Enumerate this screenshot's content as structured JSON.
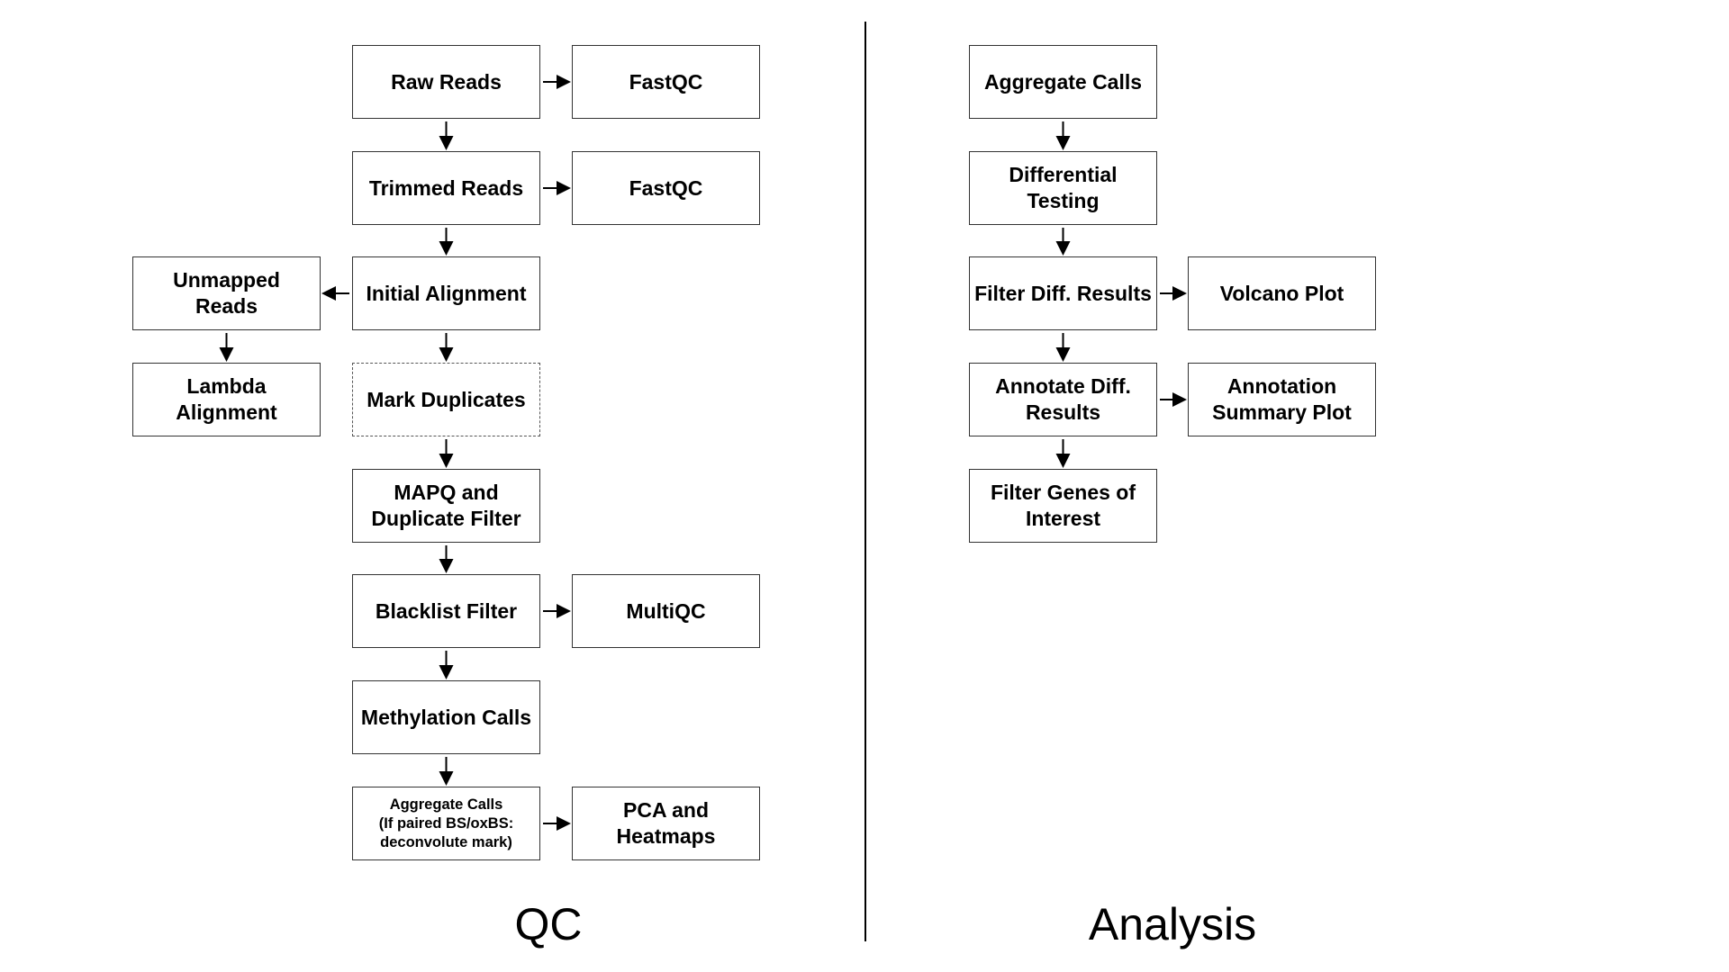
{
  "sections": {
    "qc": "QC",
    "analysis": "Analysis"
  },
  "boxes": [
    {
      "id": "raw_reads",
      "text": "Raw Reads"
    },
    {
      "id": "fastqc_1",
      "text": "FastQC"
    },
    {
      "id": "trimmed_reads",
      "text": "Trimmed Reads"
    },
    {
      "id": "fastqc_2",
      "text": "FastQC"
    },
    {
      "id": "unmapped_reads",
      "text": "Unmapped\nReads"
    },
    {
      "id": "initial_alignment",
      "text": "Initial Alignment"
    },
    {
      "id": "lambda_alignment",
      "text": "Lambda\nAlignment"
    },
    {
      "id": "mark_duplicates",
      "text": "Mark Duplicates",
      "style": "dashed"
    },
    {
      "id": "mapq_filter",
      "text": "MAPQ and\nDuplicate Filter"
    },
    {
      "id": "blacklist_filter",
      "text": "Blacklist Filter"
    },
    {
      "id": "multiqc",
      "text": "MultiQC"
    },
    {
      "id": "methylation_calls",
      "text": "Methylation Calls"
    },
    {
      "id": "aggregate_calls_qc",
      "text": "Aggregate Calls\n(If paired BS/oxBS:\ndeconvolute mark)",
      "style": "small"
    },
    {
      "id": "pca_heatmaps",
      "text": "PCA and\nHeatmaps"
    },
    {
      "id": "aggregate_calls",
      "text": "Aggregate Calls"
    },
    {
      "id": "differential_testing",
      "text": "Differential\nTesting"
    },
    {
      "id": "filter_diff_results",
      "text": "Filter Diff. Results"
    },
    {
      "id": "volcano_plot",
      "text": "Volcano Plot"
    },
    {
      "id": "annotate_diff_results",
      "text": "Annotate Diff.\nResults"
    },
    {
      "id": "annotation_summary_plot",
      "text": "Annotation\nSummary Plot"
    },
    {
      "id": "filter_genes",
      "text": "Filter Genes of\nInterest"
    }
  ],
  "edges": [
    [
      "raw_reads",
      "fastqc_1"
    ],
    [
      "raw_reads",
      "trimmed_reads"
    ],
    [
      "trimmed_reads",
      "fastqc_2"
    ],
    [
      "trimmed_reads",
      "initial_alignment"
    ],
    [
      "initial_alignment",
      "unmapped_reads"
    ],
    [
      "initial_alignment",
      "mark_duplicates"
    ],
    [
      "unmapped_reads",
      "lambda_alignment"
    ],
    [
      "mark_duplicates",
      "mapq_filter"
    ],
    [
      "mapq_filter",
      "blacklist_filter"
    ],
    [
      "blacklist_filter",
      "multiqc"
    ],
    [
      "blacklist_filter",
      "methylation_calls"
    ],
    [
      "methylation_calls",
      "aggregate_calls_qc"
    ],
    [
      "aggregate_calls_qc",
      "pca_heatmaps"
    ],
    [
      "aggregate_calls",
      "differential_testing"
    ],
    [
      "differential_testing",
      "filter_diff_results"
    ],
    [
      "filter_diff_results",
      "volcano_plot"
    ],
    [
      "filter_diff_results",
      "annotate_diff_results"
    ],
    [
      "annotate_diff_results",
      "annotation_summary_plot"
    ],
    [
      "annotate_diff_results",
      "filter_genes"
    ]
  ]
}
